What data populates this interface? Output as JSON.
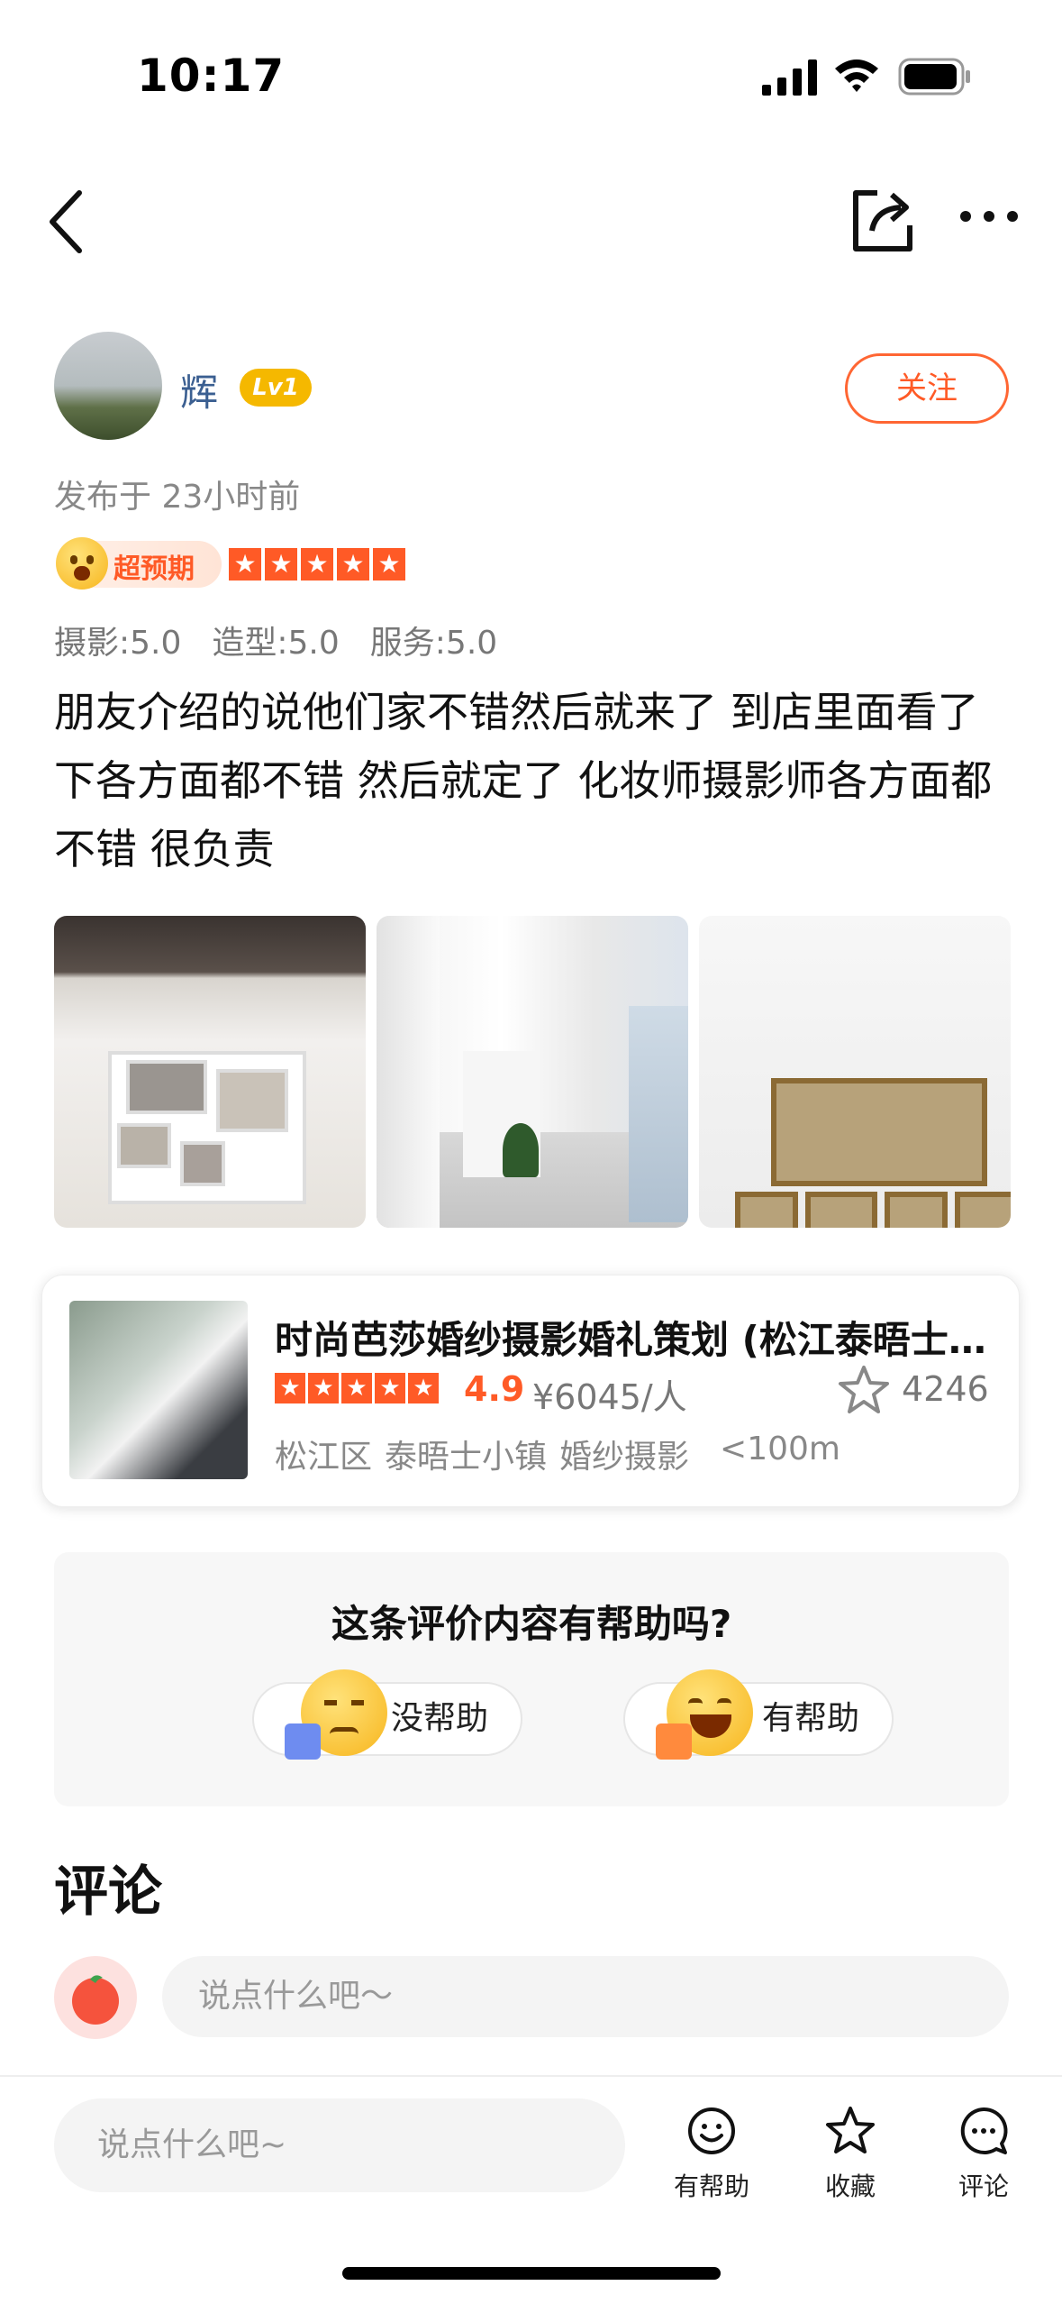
{
  "status_bar": {
    "time": "10:17"
  },
  "nav": {
    "back_icon": "chevron-left-icon",
    "share_icon": "share-icon",
    "more_icon": "more-dots-icon"
  },
  "author": {
    "name": "辉",
    "level": "Lv1",
    "follow_label": "关注",
    "publish_time": "发布于 23小时前"
  },
  "rating": {
    "expectation_label": "超预期",
    "stars": 5,
    "sub_ratings": [
      "摄影:5.0",
      "造型:5.0",
      "服务:5.0"
    ]
  },
  "review": {
    "text": "朋友介绍的说他们家不错然后就来了 到店里面看了下各方面都不错 然后就定了 化妆师摄影师各方面都不错 很负责"
  },
  "shop": {
    "name": "时尚芭莎婚纱摄影婚礼策划 (松江泰晤士小镇店)",
    "stars": 5,
    "score": "4.9",
    "price": "¥6045/人",
    "favorites": "4246",
    "district": "松江区",
    "area": "泰晤士小镇",
    "category": "婚纱摄影",
    "distance": "<100m"
  },
  "helpful": {
    "question": "这条评价内容有帮助吗?",
    "no_label": "没帮助",
    "yes_label": "有帮助"
  },
  "comments": {
    "title": "评论",
    "placeholder": "说点什么吧～"
  },
  "bottom_bar": {
    "placeholder": "说点什么吧~",
    "helpful_label": "有帮助",
    "collect_label": "收藏",
    "comment_label": "评论"
  },
  "colors": {
    "accent": "#ff5a26",
    "level_badge": "#f5b800",
    "username": "#3b5f91"
  }
}
